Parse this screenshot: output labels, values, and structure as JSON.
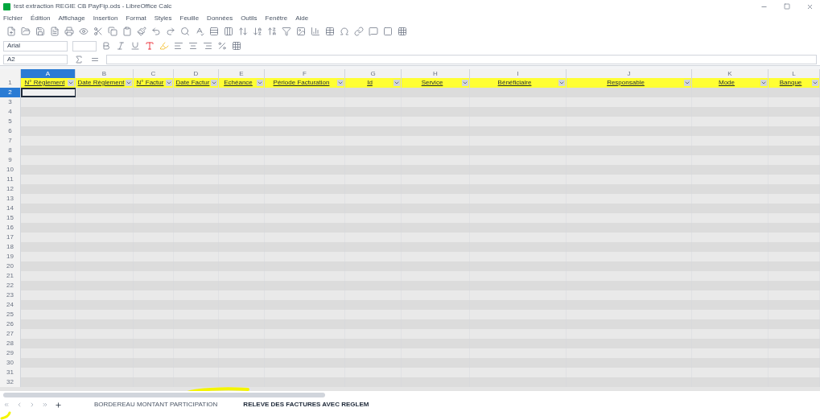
{
  "window": {
    "title": "test extraction REGIE CB PayFip.ods - LibreOffice Calc"
  },
  "menu": [
    "Fichier",
    "Édition",
    "Affichage",
    "Insertion",
    "Format",
    "Styles",
    "Feuille",
    "Données",
    "Outils",
    "Fenêtre",
    "Aide"
  ],
  "font_name": {
    "value": "Arial"
  },
  "name_box": {
    "value": "A2"
  },
  "columns": [
    {
      "letter": "A",
      "header": "N° Règlement",
      "selected": true
    },
    {
      "letter": "B",
      "header": "Date Règlement",
      "selected": false
    },
    {
      "letter": "C",
      "header": "N° Factur",
      "selected": false
    },
    {
      "letter": "D",
      "header": "Date Factur",
      "selected": false
    },
    {
      "letter": "E",
      "header": "Echéance",
      "selected": false
    },
    {
      "letter": "F",
      "header": "Période Facturation",
      "selected": false
    },
    {
      "letter": "G",
      "header": "Id",
      "selected": false
    },
    {
      "letter": "H",
      "header": "Service",
      "selected": false
    },
    {
      "letter": "I",
      "header": "Bénéficiaire",
      "selected": false
    },
    {
      "letter": "J",
      "header": "Responsable",
      "selected": false
    },
    {
      "letter": "K",
      "header": "Mode",
      "selected": false
    },
    {
      "letter": "L",
      "header": "Banque",
      "selected": false
    }
  ],
  "rows": [
    {
      "number": "1",
      "selected": false
    },
    {
      "number": "2",
      "selected": true
    },
    {
      "number": "3",
      "selected": false
    },
    {
      "number": "4",
      "selected": false
    },
    {
      "number": "5",
      "selected": false
    },
    {
      "number": "6",
      "selected": false
    },
    {
      "number": "7",
      "selected": false
    },
    {
      "number": "8",
      "selected": false
    },
    {
      "number": "9",
      "selected": false
    },
    {
      "number": "10",
      "selected": false
    },
    {
      "number": "11",
      "selected": false
    },
    {
      "number": "12",
      "selected": false
    },
    {
      "number": "13",
      "selected": false
    },
    {
      "number": "14",
      "selected": false
    },
    {
      "number": "15",
      "selected": false
    },
    {
      "number": "16",
      "selected": false
    },
    {
      "number": "17",
      "selected": false
    },
    {
      "number": "18",
      "selected": false
    },
    {
      "number": "19",
      "selected": false
    },
    {
      "number": "20",
      "selected": false
    },
    {
      "number": "21",
      "selected": false
    },
    {
      "number": "22",
      "selected": false
    },
    {
      "number": "23",
      "selected": false
    },
    {
      "number": "24",
      "selected": false
    },
    {
      "number": "25",
      "selected": false
    },
    {
      "number": "26",
      "selected": false
    },
    {
      "number": "27",
      "selected": false
    },
    {
      "number": "28",
      "selected": false
    },
    {
      "number": "29",
      "selected": false
    },
    {
      "number": "30",
      "selected": false
    },
    {
      "number": "31",
      "selected": false
    },
    {
      "number": "32",
      "selected": false
    }
  ],
  "sheet_tabs": [
    {
      "label": "BORDEREAU MONTANT PARTICIPATION",
      "selected": false
    },
    {
      "label": "RELEVE DES FACTURES AVEC REGLEM",
      "selected": true
    }
  ]
}
